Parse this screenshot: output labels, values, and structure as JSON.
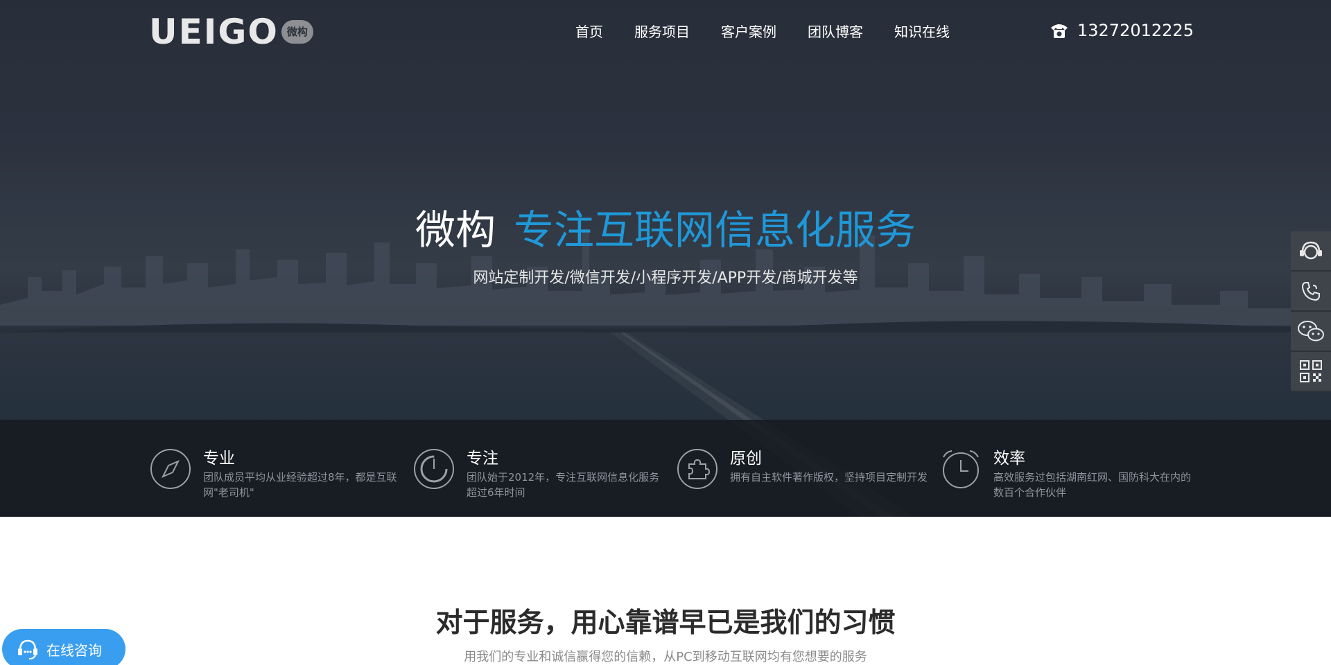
{
  "brand": {
    "logo_text": "UEIGO",
    "logo_badge": "微构"
  },
  "nav": {
    "items": [
      {
        "label": "首页"
      },
      {
        "label": "服务项目"
      },
      {
        "label": "客户案例"
      },
      {
        "label": "团队博客"
      },
      {
        "label": "知识在线"
      }
    ],
    "phone": "13272012225",
    "phone_icon": "phone-icon"
  },
  "hero": {
    "brand_word": "微构",
    "slogan": "专注互联网信息化服务",
    "subline": "网站定制开发/微信开发/小程序开发/APP开发/商城开发等",
    "slogan_color": "#1f98d8"
  },
  "features": [
    {
      "icon": "compass-icon",
      "title": "专业",
      "desc": "团队成员平均从业经验超过8年，都是互联网\"老司机\""
    },
    {
      "icon": "dial-icon",
      "title": "专注",
      "desc": "团队始于2012年，专注互联网信息化服务超过6年时间"
    },
    {
      "icon": "puzzle-icon",
      "title": "原创",
      "desc": "拥有自主软件著作版权，坚持项目定制开发"
    },
    {
      "icon": "alarm-clock-icon",
      "title": "效率",
      "desc": "高效服务过包括湖南红网、国防科大在内的数百个合作伙伴"
    }
  ],
  "sidebar": [
    {
      "icon": "headset-icon"
    },
    {
      "icon": "phone-call-icon"
    },
    {
      "icon": "wechat-icon"
    },
    {
      "icon": "qrcode-icon"
    }
  ],
  "section": {
    "title": "对于服务，用心靠谱早已是我们的习惯",
    "subtitle": "用我们的专业和诚信赢得您的信赖，从PC到移动互联网均有您想要的服务"
  },
  "consult": {
    "label": "在线咨询",
    "icon": "headset-icon",
    "color": "#3a9ef0"
  }
}
